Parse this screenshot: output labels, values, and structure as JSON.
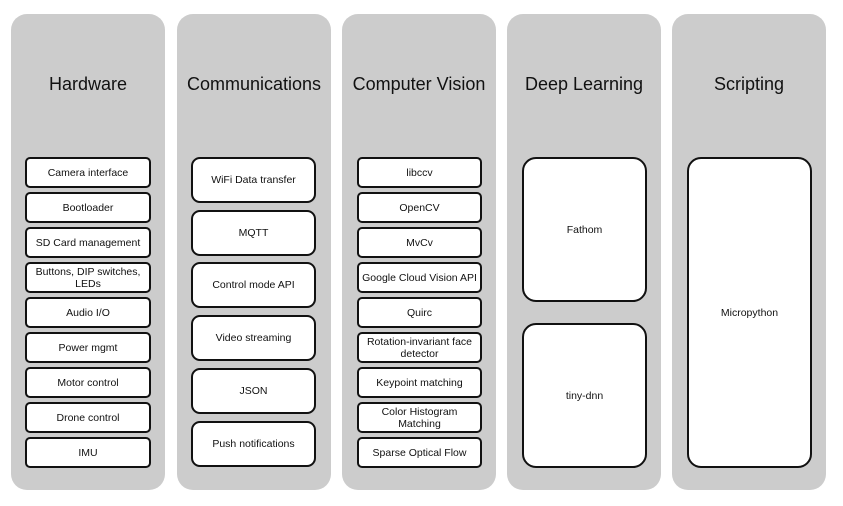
{
  "columns": [
    {
      "title": "Hardware",
      "items": [
        "Camera interface",
        "Bootloader",
        "SD Card management",
        "Buttons, DIP switches, LEDs",
        "Audio I/O",
        "Power mgmt",
        "Motor control",
        "Drone control",
        "IMU"
      ]
    },
    {
      "title": "Communications",
      "items": [
        "WiFi Data transfer",
        "MQTT",
        "Control mode API",
        "Video streaming",
        "JSON",
        "Push notifications"
      ]
    },
    {
      "title": "Computer Vision",
      "items": [
        "libccv",
        "OpenCV",
        "MvCv",
        "Google Cloud Vision API",
        "Quirc",
        "Rotation-invariant face detector",
        "Keypoint matching",
        "Color Histogram Matching",
        "Sparse Optical Flow"
      ]
    },
    {
      "title": "Deep Learning",
      "items": [
        "Fathom",
        "tiny-dnn"
      ]
    },
    {
      "title": "Scripting",
      "items": [
        "Micropython"
      ]
    }
  ],
  "colors": {
    "column_bg": "#cccccc",
    "box_bg": "#ffffff",
    "box_border": "#111111"
  }
}
